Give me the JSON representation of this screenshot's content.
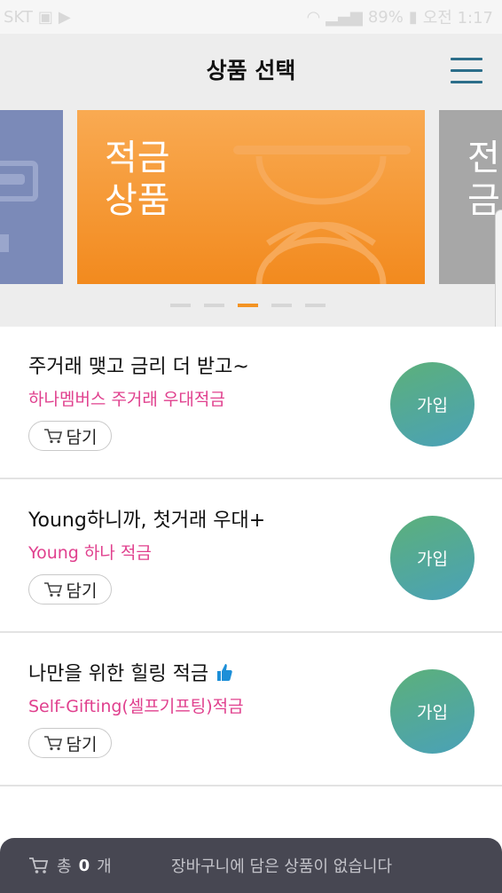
{
  "status_bar": {
    "carrier": "SKT",
    "battery": "89%",
    "time": "오전 1:17"
  },
  "header": {
    "title": "상품 선택"
  },
  "carousel": {
    "prev_title": "",
    "current_title": "적금\n상품",
    "next_title": "전\n금",
    "dot_count": 5,
    "active_index": 2
  },
  "products": [
    {
      "headline": "주거래 맺고 금리 더 받고~",
      "name": "하나멤버스 주거래 우대적금",
      "cart_label": "담기",
      "join_label": "가입",
      "has_thumb": false
    },
    {
      "headline": "Young하니까, 첫거래 우대+",
      "name": "Young 하나 적금",
      "cart_label": "담기",
      "join_label": "가입",
      "has_thumb": false
    },
    {
      "headline": "나만을 위한 힐링 적금",
      "name": "Self-Gifting(셀프기프팅)적금",
      "cart_label": "담기",
      "join_label": "가입",
      "has_thumb": true
    }
  ],
  "bottom_bar": {
    "count_prefix": "총",
    "count_value": "0",
    "count_suffix": "개",
    "message": "장바구니에 담은 상품이 없습니다"
  },
  "colors": {
    "accent_orange": "#f39323",
    "product_name_pink": "#e0408e",
    "join_gradient_start": "#5cb07a",
    "join_gradient_end": "#4aa1b8",
    "menu_icon": "#2c6e8a",
    "bottom_bar_bg": "#474752"
  }
}
